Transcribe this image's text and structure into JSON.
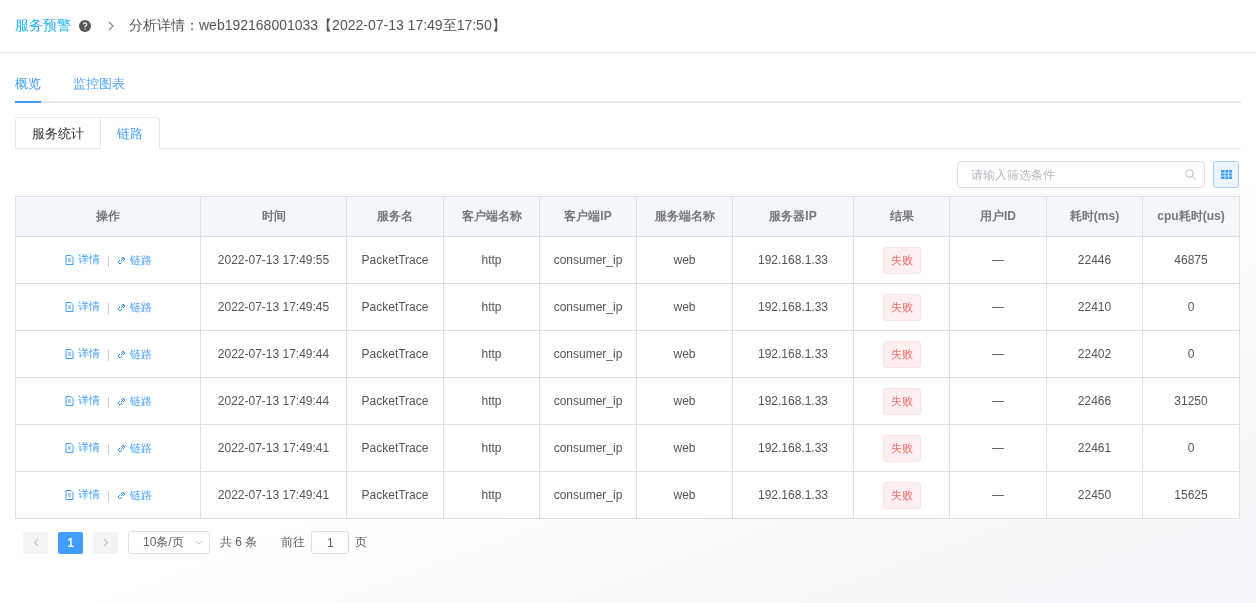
{
  "breadcrumb": {
    "root": "服务预警",
    "current": "分析详情：web192168001033【2022-07-13 17:49至17:50】"
  },
  "tabs": [
    {
      "label": "概览",
      "selected": true
    },
    {
      "label": "监控图表",
      "selected": false
    }
  ],
  "subtabs": [
    {
      "label": "服务统计",
      "selected": false
    },
    {
      "label": "链路",
      "selected": true
    }
  ],
  "search": {
    "placeholder": "请输入筛选条件"
  },
  "table": {
    "columns": [
      "操作",
      "时间",
      "服务名",
      "客户端名称",
      "客户端IP",
      "服务端名称",
      "服务器IP",
      "结果",
      "用户ID",
      "耗时(ms)",
      "cpu耗时(us)"
    ],
    "rows": [
      {
        "cells": [
          {
            "kind": "actions",
            "links": [
              "详情",
              "链路"
            ]
          },
          {
            "kind": "text",
            "text": "2022-07-13 17:49:55"
          },
          {
            "kind": "text",
            "text": "PacketTrace"
          },
          {
            "kind": "text",
            "text": "http"
          },
          {
            "kind": "text",
            "text": "consumer_ip"
          },
          {
            "kind": "text",
            "text": "web"
          },
          {
            "kind": "text",
            "text": "192.168.1.33"
          },
          {
            "kind": "fail",
            "text": "失败"
          },
          {
            "kind": "text",
            "text": "—"
          },
          {
            "kind": "text",
            "text": "22446"
          },
          {
            "kind": "text",
            "text": "46875"
          }
        ]
      },
      {
        "cells": [
          {
            "kind": "actions",
            "links": [
              "详情",
              "链路"
            ]
          },
          {
            "kind": "text",
            "text": "2022-07-13 17:49:45"
          },
          {
            "kind": "text",
            "text": "PacketTrace"
          },
          {
            "kind": "text",
            "text": "http"
          },
          {
            "kind": "text",
            "text": "consumer_ip"
          },
          {
            "kind": "text",
            "text": "web"
          },
          {
            "kind": "text",
            "text": "192.168.1.33"
          },
          {
            "kind": "fail",
            "text": "失败"
          },
          {
            "kind": "text",
            "text": "—"
          },
          {
            "kind": "text",
            "text": "22410"
          },
          {
            "kind": "text",
            "text": "0"
          }
        ]
      },
      {
        "cells": [
          {
            "kind": "actions",
            "links": [
              "详情",
              "链路"
            ]
          },
          {
            "kind": "text",
            "text": "2022-07-13 17:49:44"
          },
          {
            "kind": "text",
            "text": "PacketTrace"
          },
          {
            "kind": "text",
            "text": "http"
          },
          {
            "kind": "text",
            "text": "consumer_ip"
          },
          {
            "kind": "text",
            "text": "web"
          },
          {
            "kind": "text",
            "text": "192.168.1.33"
          },
          {
            "kind": "fail",
            "text": "失败"
          },
          {
            "kind": "text",
            "text": "—"
          },
          {
            "kind": "text",
            "text": "22402"
          },
          {
            "kind": "text",
            "text": "0"
          }
        ]
      },
      {
        "cells": [
          {
            "kind": "actions",
            "links": [
              "详情",
              "链路"
            ]
          },
          {
            "kind": "text",
            "text": "2022-07-13 17:49:44"
          },
          {
            "kind": "text",
            "text": "PacketTrace"
          },
          {
            "kind": "text",
            "text": "http"
          },
          {
            "kind": "text",
            "text": "consumer_ip"
          },
          {
            "kind": "text",
            "text": "web"
          },
          {
            "kind": "text",
            "text": "192.168.1.33"
          },
          {
            "kind": "fail",
            "text": "失败"
          },
          {
            "kind": "text",
            "text": "—"
          },
          {
            "kind": "text",
            "text": "22466"
          },
          {
            "kind": "text",
            "text": "31250"
          }
        ]
      },
      {
        "cells": [
          {
            "kind": "actions",
            "links": [
              "详情",
              "链路"
            ]
          },
          {
            "kind": "text",
            "text": "2022-07-13 17:49:41"
          },
          {
            "kind": "text",
            "text": "PacketTrace"
          },
          {
            "kind": "text",
            "text": "http"
          },
          {
            "kind": "text",
            "text": "consumer_ip"
          },
          {
            "kind": "text",
            "text": "web"
          },
          {
            "kind": "text",
            "text": "192.168.1.33"
          },
          {
            "kind": "fail",
            "text": "失败"
          },
          {
            "kind": "text",
            "text": "—"
          },
          {
            "kind": "text",
            "text": "22461"
          },
          {
            "kind": "text",
            "text": "0"
          }
        ]
      },
      {
        "cells": [
          {
            "kind": "actions",
            "links": [
              "详情",
              "链路"
            ]
          },
          {
            "kind": "text",
            "text": "2022-07-13 17:49:41"
          },
          {
            "kind": "text",
            "text": "PacketTrace"
          },
          {
            "kind": "text",
            "text": "http"
          },
          {
            "kind": "text",
            "text": "consumer_ip"
          },
          {
            "kind": "text",
            "text": "web"
          },
          {
            "kind": "text",
            "text": "192.168.1.33"
          },
          {
            "kind": "fail",
            "text": "失败"
          },
          {
            "kind": "text",
            "text": "—"
          },
          {
            "kind": "text",
            "text": "22450"
          },
          {
            "kind": "text",
            "text": "15625"
          }
        ]
      }
    ]
  },
  "pagination": {
    "pages": [
      {
        "label": "1",
        "selected": true
      }
    ],
    "page_size": "10条/页",
    "total": "共 6 条",
    "goto_label": "前往",
    "goto_value": "1",
    "goto_suffix": "页"
  }
}
